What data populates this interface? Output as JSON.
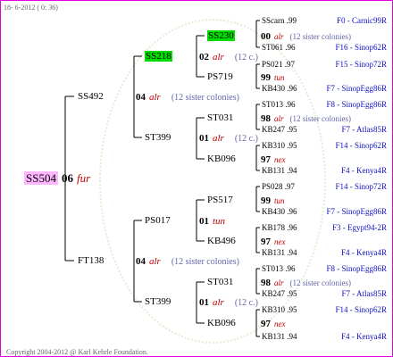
{
  "header": {
    "date": "18- 6-2012 ( 0: 36)"
  },
  "footer": {
    "copyright": "Copyright 2004-2012 @ Karl Kehrle Foundation."
  },
  "root": {
    "name": "SS504",
    "gen_num": "06",
    "gene": "fur"
  },
  "sire": {
    "name": "SS492",
    "gen_num": "04",
    "gene": "alr",
    "sisters": "(12 sister colonies)"
  },
  "dam": {
    "name": "FT138",
    "gen_num": "04",
    "gene": "alr",
    "sisters": "(12 sister colonies)"
  },
  "sire_sire": {
    "name": "SS218",
    "gen_num": "02",
    "gene": "alr",
    "sisters": "(12 c.)"
  },
  "sire_dam": {
    "name": "ST399",
    "gen_num": "01",
    "gene": "alr",
    "sisters": "(12 c.)"
  },
  "dam_sire": {
    "name": "PS017",
    "gen_num": "01",
    "gene": "tun"
  },
  "dam_dam": {
    "name": "ST399",
    "gen_num": "01",
    "gene": "alr",
    "sisters": "(12 c.)"
  },
  "g3": [
    {
      "name": "SS230",
      "gen_num": "00",
      "gene": "alr",
      "sisters": "(12 sister colonies)"
    },
    {
      "name": "PS719",
      "gen_num": "99",
      "gene": "tun"
    },
    {
      "name": "ST031",
      "gen_num": "98",
      "gene": "alr",
      "sisters": "(12 sister colonies)"
    },
    {
      "name": "KB096",
      "gen_num": "97",
      "gene": "nex"
    },
    {
      "name": "PS517",
      "gen_num": "99",
      "gene": "tun"
    },
    {
      "name": "KB496",
      "gen_num": "97",
      "gene": "nex"
    },
    {
      "name": "ST031",
      "gen_num": "98",
      "gene": "alr",
      "sisters": "(12 sister colonies)"
    },
    {
      "name": "KB096",
      "gen_num": "97",
      "gene": "nex"
    }
  ],
  "g4": [
    {
      "name": "SScarn .99",
      "line": "F0 - Carnic99R"
    },
    {
      "name": "ST061 .96",
      "line": "F16 - Sinop62R"
    },
    {
      "name": "PS021 .97",
      "line": "F15 - Sinop72R"
    },
    {
      "name": "KB430 .96",
      "line": "F7 - SinopEgg86R"
    },
    {
      "name": "ST013 .96",
      "line": "F8 - SinopEgg86R"
    },
    {
      "name": "KB247 .95",
      "line": "F7 - Atlas85R"
    },
    {
      "name": "KB310 .95",
      "line": "F14 - Sinop62R"
    },
    {
      "name": "KB131 .94",
      "line": "F4 - Kenya4R"
    },
    {
      "name": "PS028 .97",
      "line": "F14 - Sinop72R"
    },
    {
      "name": "KB430 .96",
      "line": "F7 - SinopEgg86R"
    },
    {
      "name": "KB178 .96",
      "line": "F3 - Egypt94-2R"
    },
    {
      "name": "KB131 .94",
      "line": "F4 - Kenya4R"
    },
    {
      "name": "ST013 .96",
      "line": "F8 - SinopEgg86R"
    },
    {
      "name": "KB247 .95",
      "line": "F7 - Atlas85R"
    },
    {
      "name": "KB310 .95",
      "line": "F14 - Sinop62R"
    },
    {
      "name": "KB131 .94",
      "line": "F4 - Kenya4R"
    }
  ]
}
